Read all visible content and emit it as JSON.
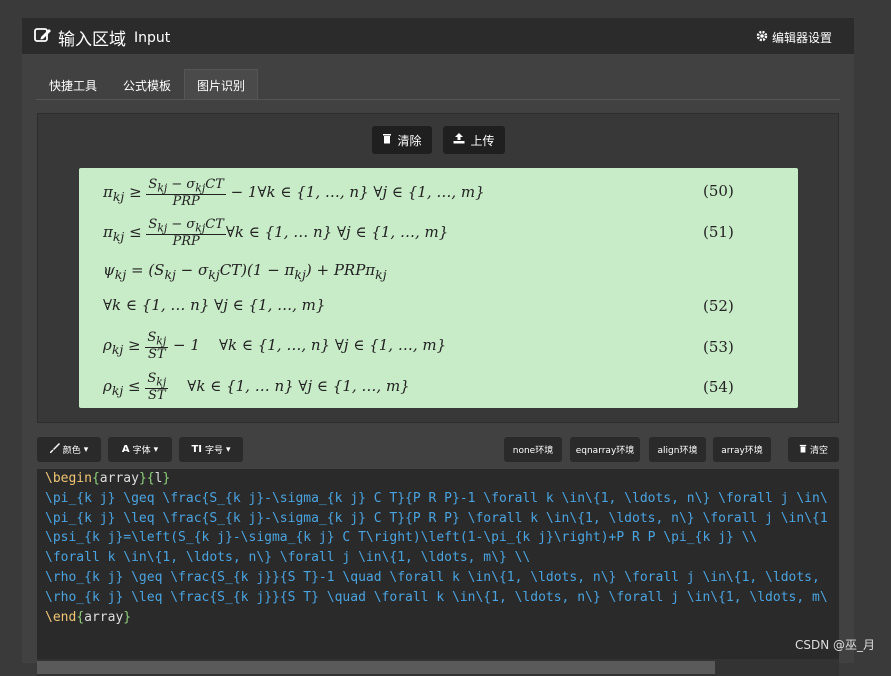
{
  "header": {
    "title": "输入区域",
    "title_en": "Input",
    "settings_label": "编辑器设置"
  },
  "tabs": [
    {
      "label": "快捷工具"
    },
    {
      "label": "公式模板"
    },
    {
      "label": "图片识别"
    }
  ],
  "image_panel": {
    "clear_label": "清除",
    "upload_label": "上传",
    "equation_numbers": [
      "(50)",
      "(51)",
      "(52)",
      "(53)",
      "(54)"
    ]
  },
  "toolbar": {
    "color_label": "颜色",
    "font_label": "字体",
    "size_label": "字号",
    "none_env": "none环境",
    "eqnarray_env": "eqnarray环境",
    "align_env": "align环境",
    "array_env": "array环境",
    "clear_label": "清空"
  },
  "editor": {
    "lines": [
      "\\begin{array}{l}",
      "\\pi_{k j} \\geq \\frac{S_{k j}-\\sigma_{k j} C T}{P R P}-1 \\forall k \\in\\{1, \\ldots, n\\} \\forall j \\in\\",
      "\\pi_{k j} \\leq \\frac{S_{k j}-\\sigma_{k j} C T}{P R P} \\forall k \\in\\{1, \\ldots, n\\} \\forall j \\in\\{1",
      "\\psi_{k j}=\\left(S_{k j}-\\sigma_{k j} C T\\right)\\left(1-\\pi_{k j}\\right)+P R P \\pi_{k j} \\\\",
      "\\forall k \\in\\{1, \\ldots, n\\} \\forall j \\in\\{1, \\ldots, m\\} \\\\",
      "\\rho_{k j} \\geq \\frac{S_{k j}}{S T}-1 \\quad \\forall k \\in\\{1, \\ldots, n\\} \\forall j \\in\\{1, \\ldots,",
      "\\rho_{k j} \\leq \\frac{S_{k j}}{S T} \\quad \\forall k \\in\\{1, \\ldots, n\\} \\forall j \\in\\{1, \\ldots, m\\",
      "\\end{array}"
    ]
  },
  "watermark": "CSDN @巫_月",
  "colors": {
    "panel_bg": "#414141",
    "header_bg": "#2b2b2b",
    "formula_bg": "#c8ebc8",
    "command_color": "#4aa3df",
    "keyword_color": "#f0c674"
  }
}
